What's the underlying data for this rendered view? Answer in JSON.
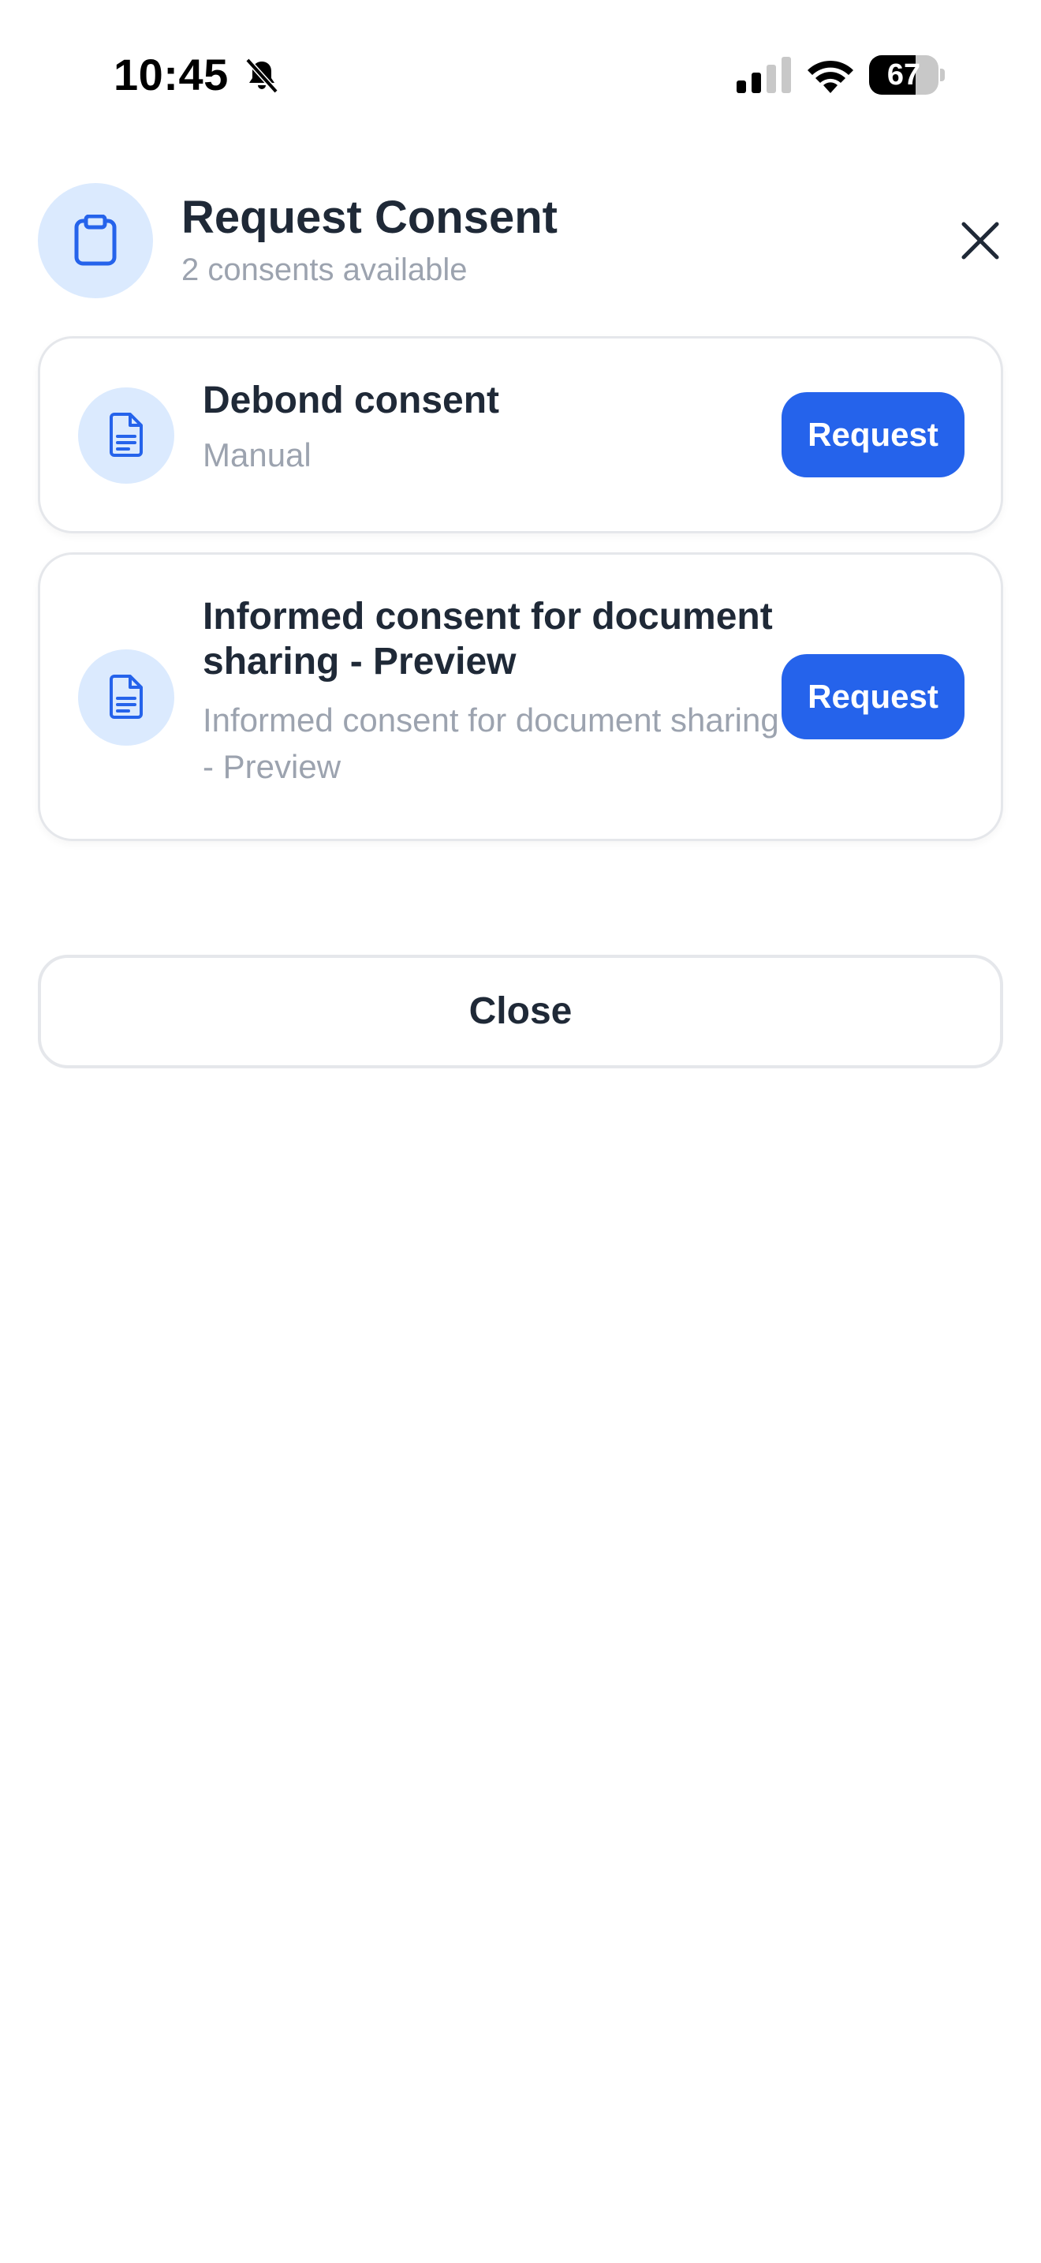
{
  "status_bar": {
    "time": "10:45",
    "battery_percent": 67,
    "battery_label": "67",
    "silent_mode": true
  },
  "header": {
    "title": "Request Consent",
    "subtitle": "2 consents available",
    "icon": "clipboard-icon",
    "close_icon": "close-icon"
  },
  "consents": [
    {
      "title": "Debond consent",
      "subtitle": "Manual",
      "icon": "document-icon",
      "button_label": "Request"
    },
    {
      "title": "Informed consent for document sharing - Preview",
      "subtitle": "Informed consent for document sharing - Preview",
      "icon": "document-icon",
      "button_label": "Request"
    }
  ],
  "footer": {
    "close_label": "Close"
  },
  "colors": {
    "accent": "#2563eb",
    "icon_bg": "#dbeafe",
    "text_primary": "#1f2937",
    "text_secondary": "#9ca3af",
    "border": "#e5e7eb"
  }
}
